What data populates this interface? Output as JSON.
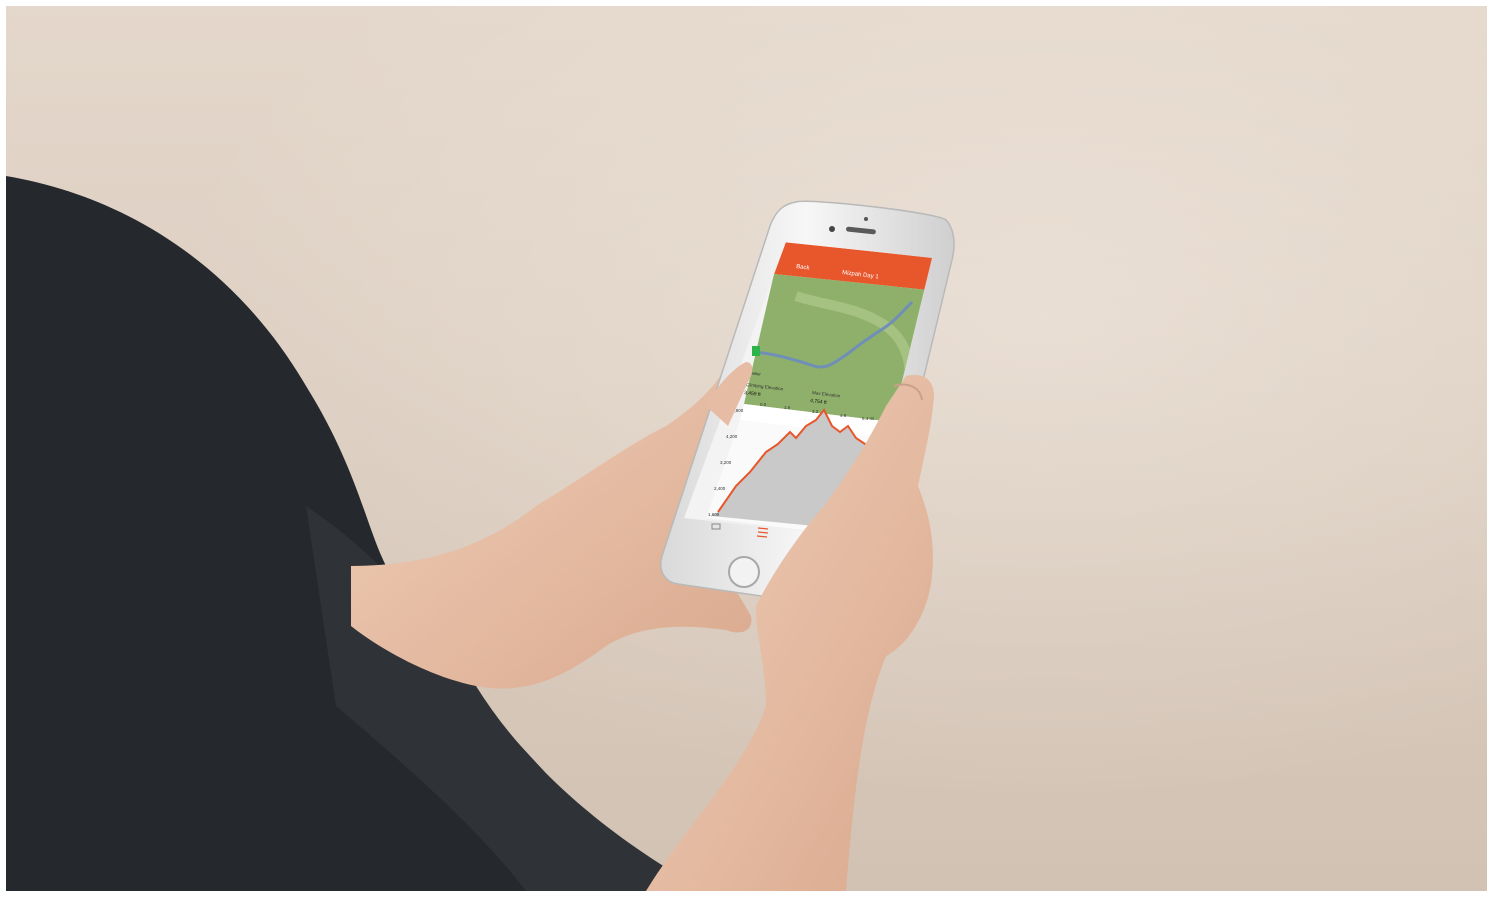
{
  "screen": {
    "back_label": "Back",
    "title": "Mizpah Day 1",
    "map_label": "Shelter",
    "stat_1_label": "Climbing Elevation",
    "stat_1_value": "3,459 ft",
    "stat_2_label": "Max Elevation",
    "stat_2_value": "4,754 ft",
    "x_ticks": [
      "0.0",
      "1.6",
      "3.2",
      "4.8",
      "6.4 mi"
    ],
    "y_ticks": [
      "4,800",
      "4,200",
      "3,200",
      "2,400",
      "1,600"
    ]
  },
  "colors": {
    "accent": "#e8562b",
    "map_green": "#8fb06a",
    "route_blue": "#6f8fb8",
    "profile_line": "#e8562b",
    "profile_fill": "#c9c9c9"
  },
  "icons": [
    "back-chevron-icon",
    "map-tab-icon",
    "list-tab-icon",
    "share-tab-icon",
    "home-button-icon"
  ]
}
